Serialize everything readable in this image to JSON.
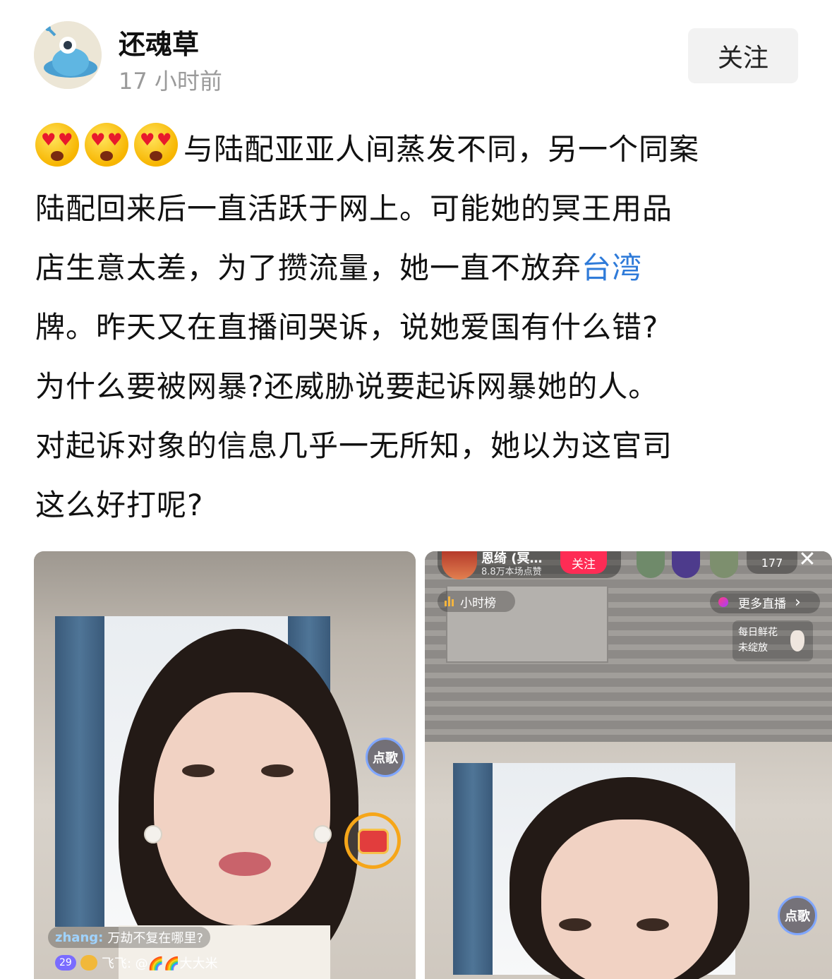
{
  "author": {
    "name": "还魂草",
    "time": "17 小时前",
    "follow_label": "关注"
  },
  "post": {
    "emoji": "heart-eyes-emoji",
    "line1": "与陆配亚亚人间蒸发不同，另一个同案",
    "line2": "陆配回来后一直活跃于网上。可能她的冥王用品",
    "line3_before_link": "店生意太差，为了攒流量，她一直不放弃",
    "link_text": "台湾",
    "line4": "牌。昨天又在直播间哭诉，说她爱国有什么错?",
    "line5": "为什么要被网暴?还威胁说要起诉网暴她的人。",
    "line6": "对起诉对象的信息几乎一无所知，她以为这官司",
    "line7": "这么好打呢?",
    "link_color": "#2f7bd9"
  },
  "left_image": {
    "song_button": "点歌",
    "chat_user": "zhang:",
    "chat_text": "万劫不复在哪里?",
    "badge_level": "29",
    "bottom_text": "飞飞: @🌈🌈大大米"
  },
  "right_image": {
    "streamer_name": "恩绮 (冥…",
    "streamer_likes": "8.8万本场点赞",
    "follow_label": "关注",
    "viewer_count": "177",
    "close_label": "✕",
    "rank_label": "小时榜",
    "more_live_label": "更多直播",
    "more_live_arrow": "›",
    "flower_line1": "每日鲜花",
    "flower_line2": "未绽放",
    "song_button": "点歌"
  }
}
